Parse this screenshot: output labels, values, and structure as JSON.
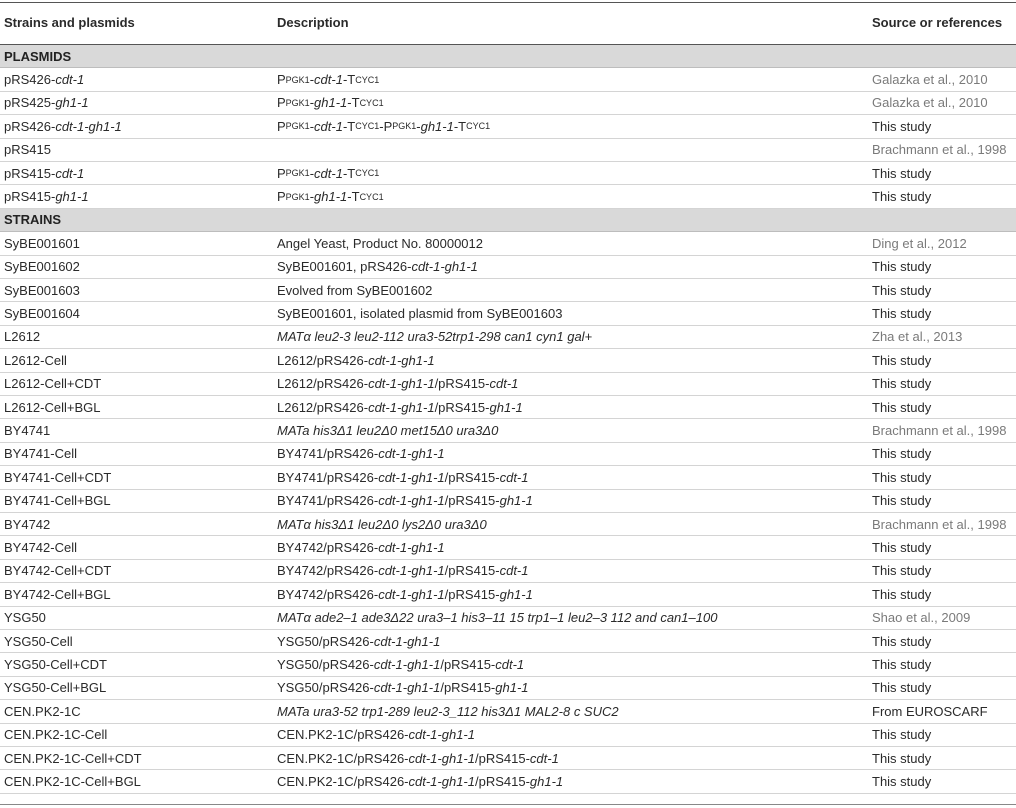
{
  "headers": {
    "strain": "Strains and plasmids",
    "description": "Description",
    "source": "Source or references"
  },
  "rows": [
    {
      "section": "PLASMIDS"
    },
    {
      "name": [
        [
          "pRS426-",
          false
        ],
        [
          "cdt-1",
          true
        ]
      ],
      "desc": [
        [
          "P",
          false,
          false
        ],
        [
          "PGK1",
          false,
          true
        ],
        [
          "-",
          false,
          false
        ],
        [
          "cdt-1",
          true,
          false
        ],
        [
          "-T",
          false,
          false
        ],
        [
          "CYC1",
          false,
          true
        ]
      ],
      "source": "Galazka et al., 2010",
      "gray": true
    },
    {
      "name": [
        [
          "pRS425-",
          false
        ],
        [
          "gh1-1",
          true
        ]
      ],
      "desc": [
        [
          "P",
          false,
          false
        ],
        [
          "PGK1",
          false,
          true
        ],
        [
          "-",
          false,
          false
        ],
        [
          "gh1-1",
          true,
          false
        ],
        [
          "-T",
          false,
          false
        ],
        [
          "CYC1",
          false,
          true
        ]
      ],
      "source": "Galazka et al., 2010",
      "gray": true
    },
    {
      "name": [
        [
          "pRS426-",
          false
        ],
        [
          "cdt-1-gh1-1",
          true
        ]
      ],
      "desc": [
        [
          "P",
          false,
          false
        ],
        [
          "PGK1",
          false,
          true
        ],
        [
          "-",
          false,
          false
        ],
        [
          "cdt-1",
          true,
          false
        ],
        [
          "-T",
          false,
          false
        ],
        [
          "CYC1",
          false,
          true
        ],
        [
          "-P",
          false,
          false
        ],
        [
          "PGK1",
          false,
          true
        ],
        [
          "-",
          false,
          false
        ],
        [
          "gh1-1",
          true,
          false
        ],
        [
          "-T",
          false,
          false
        ],
        [
          "CYC1",
          false,
          true
        ]
      ],
      "source": "This study",
      "gray": false
    },
    {
      "name": [
        [
          "pRS415",
          false
        ]
      ],
      "desc": [],
      "source": "Brachmann et al., 1998",
      "gray": true
    },
    {
      "name": [
        [
          "pRS415-",
          false
        ],
        [
          "cdt-1",
          true
        ]
      ],
      "desc": [
        [
          "P",
          false,
          false
        ],
        [
          "PGK1",
          false,
          true
        ],
        [
          "-",
          false,
          false
        ],
        [
          "cdt-1",
          true,
          false
        ],
        [
          "-T",
          false,
          false
        ],
        [
          "CYC1",
          false,
          true
        ]
      ],
      "source": "This study",
      "gray": false
    },
    {
      "name": [
        [
          "pRS415-",
          false
        ],
        [
          "gh1-1",
          true
        ]
      ],
      "desc": [
        [
          "P",
          false,
          false
        ],
        [
          "PGK1",
          false,
          true
        ],
        [
          "-",
          false,
          false
        ],
        [
          "gh1-1",
          true,
          false
        ],
        [
          "-T",
          false,
          false
        ],
        [
          "CYC1",
          false,
          true
        ]
      ],
      "source": "This study",
      "gray": false
    },
    {
      "section": "STRAINS"
    },
    {
      "name": [
        [
          "SyBE001601",
          false
        ]
      ],
      "desc": [
        [
          "Angel Yeast, Product No. 80000012",
          false,
          false
        ]
      ],
      "source": "Ding et al., 2012",
      "gray": true
    },
    {
      "name": [
        [
          "SyBE001602",
          false
        ]
      ],
      "desc": [
        [
          "SyBE001601, pRS426-",
          false,
          false
        ],
        [
          "cdt-1-gh1-1",
          true,
          false
        ]
      ],
      "source": "This study",
      "gray": false
    },
    {
      "name": [
        [
          "SyBE001603",
          false
        ]
      ],
      "desc": [
        [
          "Evolved from SyBE001602",
          false,
          false
        ]
      ],
      "source": "This study",
      "gray": false
    },
    {
      "name": [
        [
          "SyBE001604",
          false
        ]
      ],
      "desc": [
        [
          "SyBE001601, isolated plasmid from SyBE001603",
          false,
          false
        ]
      ],
      "source": "This study",
      "gray": false
    },
    {
      "name": [
        [
          "L2612",
          false
        ]
      ],
      "desc": [
        [
          "MATα leu2-3 leu2-112 ura3-52trp1-298 can1 cyn1 gal+",
          true,
          false
        ]
      ],
      "source": "Zha et al., 2013",
      "gray": true
    },
    {
      "name": [
        [
          "L2612-Cell",
          false
        ]
      ],
      "desc": [
        [
          "L2612/pRS426-",
          false,
          false
        ],
        [
          "cdt-1-gh1-1",
          true,
          false
        ]
      ],
      "source": "This study",
      "gray": false
    },
    {
      "name": [
        [
          "L2612-Cell+CDT",
          false
        ]
      ],
      "desc": [
        [
          "L2612/pRS426-",
          false,
          false
        ],
        [
          "cdt-1-gh1-1",
          true,
          false
        ],
        [
          "/pRS415-",
          false,
          false
        ],
        [
          "cdt-1",
          true,
          false
        ]
      ],
      "source": "This study",
      "gray": false
    },
    {
      "name": [
        [
          "L2612-Cell+BGL",
          false
        ]
      ],
      "desc": [
        [
          "L2612/pRS426-",
          false,
          false
        ],
        [
          "cdt-1-gh1-1",
          true,
          false
        ],
        [
          "/pRS415-",
          false,
          false
        ],
        [
          "gh1-1",
          true,
          false
        ]
      ],
      "source": "This study",
      "gray": false
    },
    {
      "name": [
        [
          "BY4741",
          false
        ]
      ],
      "desc": [
        [
          "MATa his3Δ1 leu2Δ0 met15Δ0 ura3Δ0",
          true,
          false
        ]
      ],
      "source": "Brachmann et al., 1998",
      "gray": true
    },
    {
      "name": [
        [
          "BY4741-Cell",
          false
        ]
      ],
      "desc": [
        [
          "BY4741/pRS426-",
          false,
          false
        ],
        [
          "cdt-1-gh1-1",
          true,
          false
        ]
      ],
      "source": "This study",
      "gray": false
    },
    {
      "name": [
        [
          "BY4741-Cell+CDT",
          false
        ]
      ],
      "desc": [
        [
          "BY4741/pRS426-",
          false,
          false
        ],
        [
          "cdt-1-gh1-1",
          true,
          false
        ],
        [
          "/pRS415-",
          false,
          false
        ],
        [
          "cdt-1",
          true,
          false
        ]
      ],
      "source": "This study",
      "gray": false
    },
    {
      "name": [
        [
          "BY4741-Cell+BGL",
          false
        ]
      ],
      "desc": [
        [
          "BY4741/pRS426-",
          false,
          false
        ],
        [
          "cdt-1-gh1-1",
          true,
          false
        ],
        [
          "/pRS415-",
          false,
          false
        ],
        [
          "gh1-1",
          true,
          false
        ]
      ],
      "source": "This study",
      "gray": false
    },
    {
      "name": [
        [
          "BY4742",
          false
        ]
      ],
      "desc": [
        [
          "MATα his3Δ1 leu2Δ0 lys2Δ0 ura3Δ0",
          true,
          false
        ]
      ],
      "source": "Brachmann et al., 1998",
      "gray": true
    },
    {
      "name": [
        [
          "BY4742-Cell",
          false
        ]
      ],
      "desc": [
        [
          "BY4742/pRS426-",
          false,
          false
        ],
        [
          "cdt-1-gh1-1",
          true,
          false
        ]
      ],
      "source": "This study",
      "gray": false
    },
    {
      "name": [
        [
          "BY4742-Cell+CDT",
          false
        ]
      ],
      "desc": [
        [
          "BY4742/pRS426-",
          false,
          false
        ],
        [
          "cdt-1-gh1-1",
          true,
          false
        ],
        [
          "/pRS415-",
          false,
          false
        ],
        [
          "cdt-1",
          true,
          false
        ]
      ],
      "source": "This study",
      "gray": false
    },
    {
      "name": [
        [
          "BY4742-Cell+BGL",
          false
        ]
      ],
      "desc": [
        [
          "BY4742/pRS426-",
          false,
          false
        ],
        [
          "cdt-1-gh1-1",
          true,
          false
        ],
        [
          "/pRS415-",
          false,
          false
        ],
        [
          "gh1-1",
          true,
          false
        ]
      ],
      "source": "This study",
      "gray": false
    },
    {
      "name": [
        [
          "YSG50",
          false
        ]
      ],
      "desc": [
        [
          "MATα ade2–1 ade3Δ22 ura3–1 his3–11 15 trp1–1 leu2–3 112 and can1–100",
          true,
          false
        ]
      ],
      "source": "Shao et al., 2009",
      "gray": true
    },
    {
      "name": [
        [
          "YSG50-Cell",
          false
        ]
      ],
      "desc": [
        [
          "YSG50/pRS426-",
          false,
          false
        ],
        [
          "cdt-1-gh1-1",
          true,
          false
        ]
      ],
      "source": "This study",
      "gray": false
    },
    {
      "name": [
        [
          "YSG50-Cell+CDT",
          false
        ]
      ],
      "desc": [
        [
          "YSG50/pRS426-",
          false,
          false
        ],
        [
          "cdt-1-gh1-1",
          true,
          false
        ],
        [
          "/pRS415-",
          false,
          false
        ],
        [
          "cdt-1",
          true,
          false
        ]
      ],
      "source": "This study",
      "gray": false
    },
    {
      "name": [
        [
          "YSG50-Cell+BGL",
          false
        ]
      ],
      "desc": [
        [
          "YSG50/pRS426-",
          false,
          false
        ],
        [
          "cdt-1-gh1-1",
          true,
          false
        ],
        [
          "/pRS415-",
          false,
          false
        ],
        [
          "gh1-1",
          true,
          false
        ]
      ],
      "source": "This study",
      "gray": false
    },
    {
      "name": [
        [
          "CEN.PK2-1C",
          false
        ]
      ],
      "desc": [
        [
          "MATa ura3-52 trp1-289 leu2-3_112 his3Δ1 MAL2-8 c SUC2",
          true,
          false
        ]
      ],
      "source": "From EUROSCARF",
      "gray": false
    },
    {
      "name": [
        [
          "CEN.PK2-1C-Cell",
          false
        ]
      ],
      "desc": [
        [
          "CEN.PK2-1C/pRS426-",
          false,
          false
        ],
        [
          "cdt-1-gh1-1",
          true,
          false
        ]
      ],
      "source": "This study",
      "gray": false
    },
    {
      "name": [
        [
          "CEN.PK2-1C-Cell+CDT",
          false
        ]
      ],
      "desc": [
        [
          "CEN.PK2-1C/pRS426-",
          false,
          false
        ],
        [
          "cdt-1-gh1-1",
          true,
          false
        ],
        [
          "/pRS415-",
          false,
          false
        ],
        [
          "cdt-1",
          true,
          false
        ]
      ],
      "source": "This study",
      "gray": false
    },
    {
      "name": [
        [
          "CEN.PK2-1C-Cell+BGL",
          false
        ]
      ],
      "desc": [
        [
          "CEN.PK2-1C/pRS426-",
          false,
          false
        ],
        [
          "cdt-1-gh1-1",
          true,
          false
        ],
        [
          "/pRS415-",
          false,
          false
        ],
        [
          "gh1-1",
          true,
          false
        ]
      ],
      "source": "This study",
      "gray": false
    }
  ]
}
